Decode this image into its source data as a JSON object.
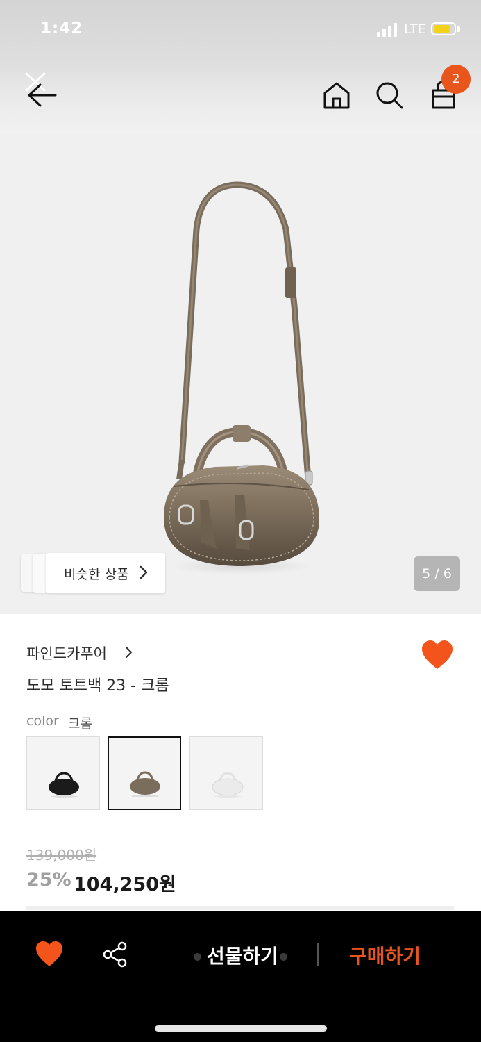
{
  "status_bar": {
    "time": "1:42",
    "network": "LTE"
  },
  "nav": {
    "back_icon": "back-arrow-icon",
    "home_icon": "home-icon",
    "search_icon": "search-icon",
    "cart_icon": "shopping-bag-icon",
    "cart_count": "2"
  },
  "gallery": {
    "similar_label": "비슷한 상품",
    "page_indicator": "5 / 6",
    "current_page": 5,
    "total_pages": 6
  },
  "product": {
    "brand": "파인드카푸어",
    "title": "도모 토트백 23 - 크롬",
    "color_label": "color",
    "color_value": "크롬",
    "color_options": [
      {
        "name": "black",
        "selected": false
      },
      {
        "name": "chrome",
        "selected": true
      },
      {
        "name": "white",
        "selected": false
      }
    ],
    "original_price": "139,000원",
    "discount": "25%",
    "sale_price": "104,250원"
  },
  "bottom_bar": {
    "gift_label": "선물하기",
    "buy_label": "구매하기"
  },
  "colors": {
    "accent": "#e8541e",
    "badge": "#e8551d",
    "bag_chrome": "#7b6d5c"
  }
}
